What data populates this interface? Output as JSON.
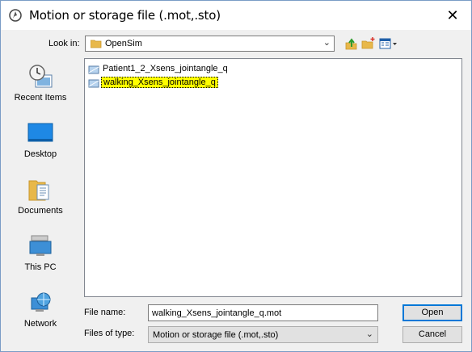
{
  "window": {
    "title": "Motion or storage file (.mot,.sto)",
    "close_glyph": "✕"
  },
  "toolbar": {
    "look_in_label": "Look in:",
    "look_in_value": "OpenSim",
    "icons": [
      "up-one-level-icon",
      "create-new-folder-icon",
      "view-menu-icon"
    ]
  },
  "places": [
    {
      "label": "Recent Items",
      "icon": "recent-items-icon"
    },
    {
      "label": "Desktop",
      "icon": "desktop-icon"
    },
    {
      "label": "Documents",
      "icon": "documents-icon"
    },
    {
      "label": "This PC",
      "icon": "this-pc-icon"
    },
    {
      "label": "Network",
      "icon": "network-icon"
    }
  ],
  "files": [
    {
      "name": "Patient1_2_Xsens_jointangle_q",
      "selected": false
    },
    {
      "name": "walking_Xsens_jointangle_q",
      "selected": true
    }
  ],
  "form": {
    "file_name_label": "File name:",
    "file_name_value": "walking_Xsens_jointangle_q.mot",
    "file_type_label": "Files of type:",
    "file_type_value": "Motion or storage file (.mot,.sto)"
  },
  "buttons": {
    "open": "Open",
    "cancel": "Cancel"
  },
  "colors": {
    "selection_highlight": "#ffff00",
    "default_button_border": "#0078d7",
    "desktop_blue": "#1e88e5"
  }
}
